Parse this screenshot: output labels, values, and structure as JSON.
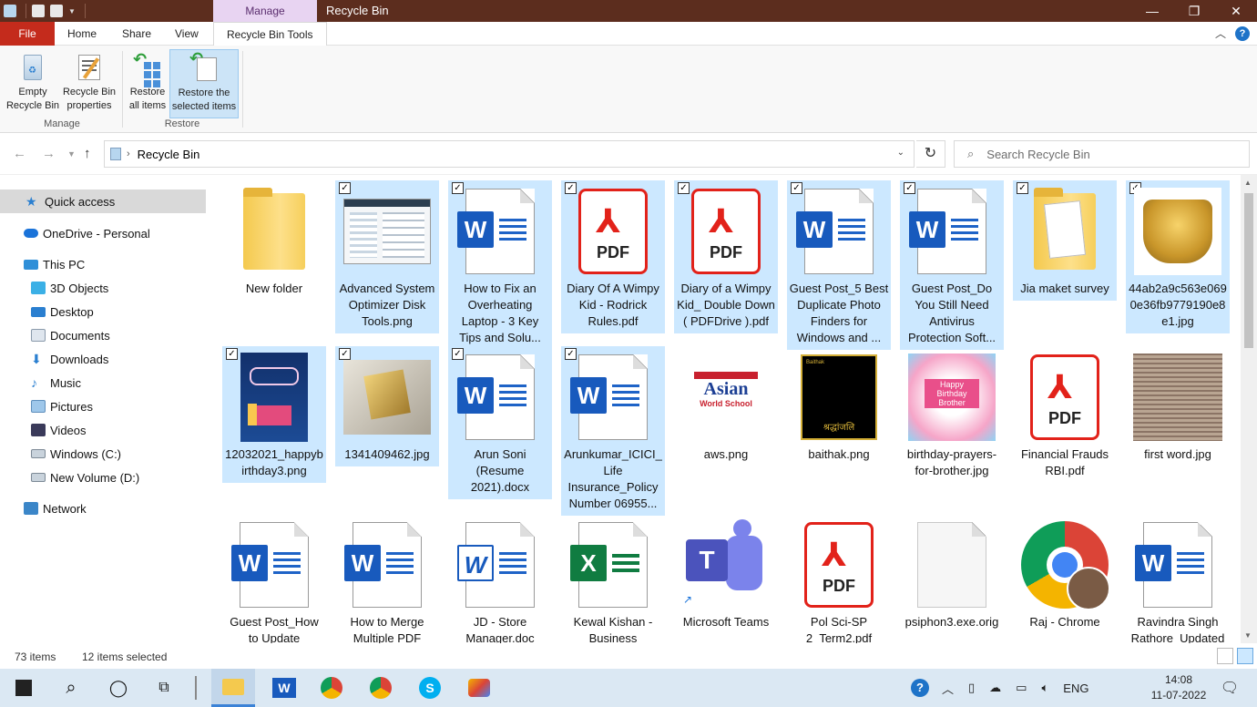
{
  "window": {
    "context_tab": "Manage",
    "title": "Recycle Bin",
    "minimize": "—",
    "maximize": "❐",
    "close": "✕"
  },
  "ribbon_tabs": {
    "file": "File",
    "home": "Home",
    "share": "Share",
    "view": "View",
    "recycle_bin_tools": "Recycle Bin Tools",
    "help": "?"
  },
  "ribbon": {
    "empty_bin_l1": "Empty",
    "empty_bin_l2": "Recycle Bin",
    "properties_l1": "Recycle Bin",
    "properties_l2": "properties",
    "manage_group": "Manage",
    "restore_all_l1": "Restore",
    "restore_all_l2": "all items",
    "restore_sel_l1": "Restore the",
    "restore_sel_l2": "selected items",
    "restore_group": "Restore"
  },
  "address": {
    "location": "Recycle Bin",
    "search_placeholder": "Search Recycle Bin"
  },
  "nav": {
    "quick_access": "Quick access",
    "onedrive": "OneDrive - Personal",
    "this_pc": "This PC",
    "objects_3d": "3D Objects",
    "desktop": "Desktop",
    "documents": "Documents",
    "downloads": "Downloads",
    "music": "Music",
    "pictures": "Pictures",
    "videos": "Videos",
    "windows_c": "Windows (C:)",
    "new_volume_d": "New Volume (D:)",
    "network": "Network"
  },
  "files": [
    {
      "name": "New folder",
      "type": "folder",
      "selected": false
    },
    {
      "name": "Advanced System Optimizer Disk Tools.png",
      "type": "screenshot",
      "selected": true
    },
    {
      "name": "How to Fix an Overheating Laptop - 3 Key Tips and Solu...",
      "type": "word",
      "selected": true
    },
    {
      "name": "Diary Of A Wimpy Kid - Rodrick Rules.pdf",
      "type": "pdf",
      "selected": true
    },
    {
      "name": "Diary of a Wimpy Kid_ Double Down ( PDFDrive ).pdf",
      "type": "pdf",
      "selected": true
    },
    {
      "name": "Guest Post_5 Best Duplicate Photo Finders for Windows and ...",
      "type": "word",
      "selected": true
    },
    {
      "name": "Guest Post_Do You Still Need Antivirus Protection Soft...",
      "type": "word",
      "selected": true
    },
    {
      "name": "Jia maket survey",
      "type": "folder-docs",
      "selected": true
    },
    {
      "name": "44ab2a9c563e0690e36fb9779190e8e1.jpg",
      "type": "gold-ring",
      "selected": true
    },
    {
      "name": "12032021_happybirthday3.png",
      "type": "birthday-card",
      "selected": true
    },
    {
      "name": "1341409462.jpg",
      "type": "gold-photo",
      "selected": true
    },
    {
      "name": "Arun Soni (Resume 2021).docx",
      "type": "word",
      "selected": true
    },
    {
      "name": "Arunkumar_ICICI_Life Insurance_Policy Number 06955...",
      "type": "word",
      "selected": true
    },
    {
      "name": "aws.png",
      "type": "aws-logo",
      "selected": false
    },
    {
      "name": "baithak.png",
      "type": "baithak",
      "selected": false
    },
    {
      "name": "birthday-prayers-for-brother.jpg",
      "type": "birthday-brother",
      "selected": false
    },
    {
      "name": "Financial Frauds RBI.pdf",
      "type": "pdf",
      "selected": false
    },
    {
      "name": "first word.jpg",
      "type": "text-image",
      "selected": false
    },
    {
      "name": "Guest Post_How to Update",
      "type": "word",
      "selected": false
    },
    {
      "name": "How to Merge Multiple PDF",
      "type": "word",
      "selected": false
    },
    {
      "name": "JD - Store Manager.doc",
      "type": "word-old",
      "selected": false
    },
    {
      "name": "Kewal Kishan - Business",
      "type": "excel",
      "selected": false
    },
    {
      "name": "Microsoft Teams",
      "type": "teams",
      "selected": false
    },
    {
      "name": "Pol Sci-SP 2_Term2.pdf",
      "type": "pdf",
      "selected": false
    },
    {
      "name": "psiphon3.exe.orig",
      "type": "blank",
      "selected": false
    },
    {
      "name": "Raj - Chrome",
      "type": "chrome",
      "selected": false
    },
    {
      "name": "Ravindra Singh Rathore_Updated",
      "type": "word",
      "selected": false
    }
  ],
  "thumb_text": {
    "pdf": "PDF",
    "word_letter": "W",
    "excel_letter": "X",
    "teams_letter": "T",
    "aws_l1": "Asian",
    "aws_l2": "World School",
    "baithak_title": "Baithak",
    "baithak_hindi": "श्रद्धांजलि",
    "bday_brother_l1": "Happy",
    "bday_brother_l2": "Birthday",
    "bday_brother_l3": "Brother"
  },
  "status": {
    "count": "73 items",
    "selected": "12 items selected"
  },
  "tray": {
    "lang": "ENG",
    "time": "14:08",
    "date": "11-07-2022"
  },
  "colors": {
    "titlebar": "#5c2d1e",
    "selection": "#cce8ff",
    "file_tab": "#c42b1c",
    "taskbar": "#dbe8f3"
  }
}
